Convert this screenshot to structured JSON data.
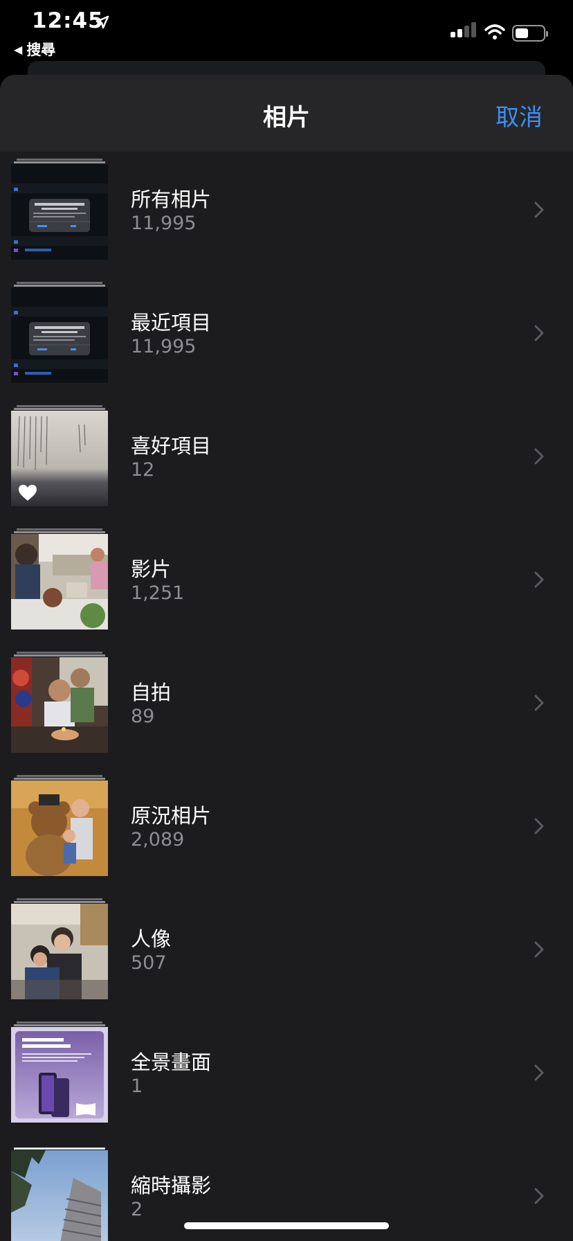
{
  "status_bar": {
    "time": "12:45",
    "back_app": "搜尋"
  },
  "nav": {
    "title": "相片",
    "cancel": "取消"
  },
  "colors": {
    "accent": "#3f8ef5",
    "sheet_bg": "#1c1c1e",
    "secondary_text": "#8d8d93"
  },
  "albums": [
    {
      "title": "所有相片",
      "count": "11,995",
      "thumb": "screenshot-dialog"
    },
    {
      "title": "最近項目",
      "count": "11,995",
      "thumb": "screenshot-dialog"
    },
    {
      "title": "喜好項目",
      "count": "12",
      "thumb": "document-photo",
      "badge": "heart-icon"
    },
    {
      "title": "影片",
      "count": "1,251",
      "thumb": "restaurant-photo"
    },
    {
      "title": "自拍",
      "count": "89",
      "thumb": "birthday-photo"
    },
    {
      "title": "原況相片",
      "count": "2,089",
      "thumb": "teddy-bear-photo"
    },
    {
      "title": "人像",
      "count": "507",
      "thumb": "family-photo"
    },
    {
      "title": "全景畫面",
      "count": "1",
      "thumb": "phone-ad-screenshot",
      "badge": "panorama-icon"
    },
    {
      "title": "縮時攝影",
      "count": "2",
      "thumb": "building-sky-photo"
    }
  ]
}
